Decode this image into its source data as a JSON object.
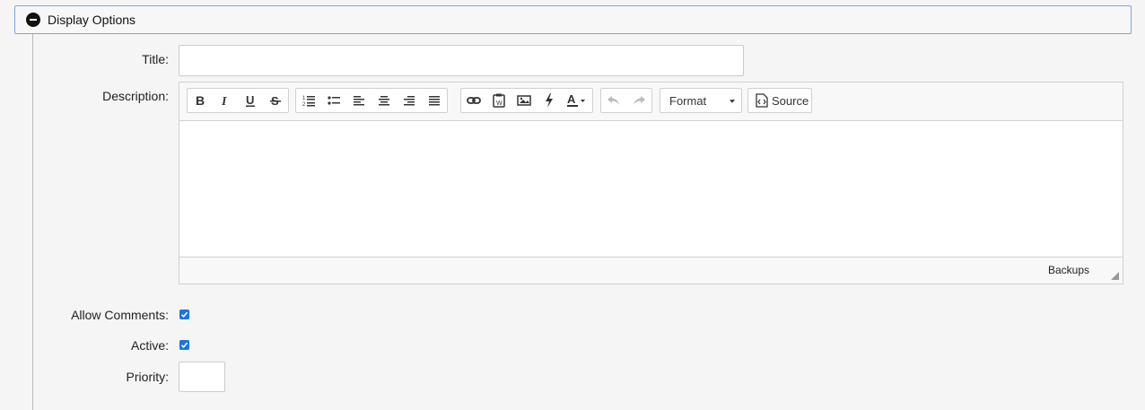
{
  "section": {
    "title": "Display Options"
  },
  "fields": {
    "title_label": "Title:",
    "title_value": "",
    "description_label": "Description:",
    "allow_comments_label": "Allow Comments:",
    "allow_comments_checked": true,
    "active_label": "Active:",
    "active_checked": true,
    "priority_label": "Priority:",
    "priority_value": ""
  },
  "editor": {
    "format_label": "Format",
    "source_label": "Source",
    "footer_label": "Backups",
    "toolbar_icons": [
      "bold-icon",
      "italic-icon",
      "underline-icon",
      "strikethrough-icon",
      "numbered-list-icon",
      "bulleted-list-icon",
      "align-left-icon",
      "align-center-icon",
      "align-right-icon",
      "justify-icon",
      "link-icon",
      "paste-from-word-icon",
      "image-icon",
      "flash-icon",
      "text-color-icon",
      "undo-icon",
      "redo-icon",
      "source-icon"
    ]
  },
  "colors": {
    "accent": "#1a73e8",
    "header_border": "#7aa6e0"
  }
}
